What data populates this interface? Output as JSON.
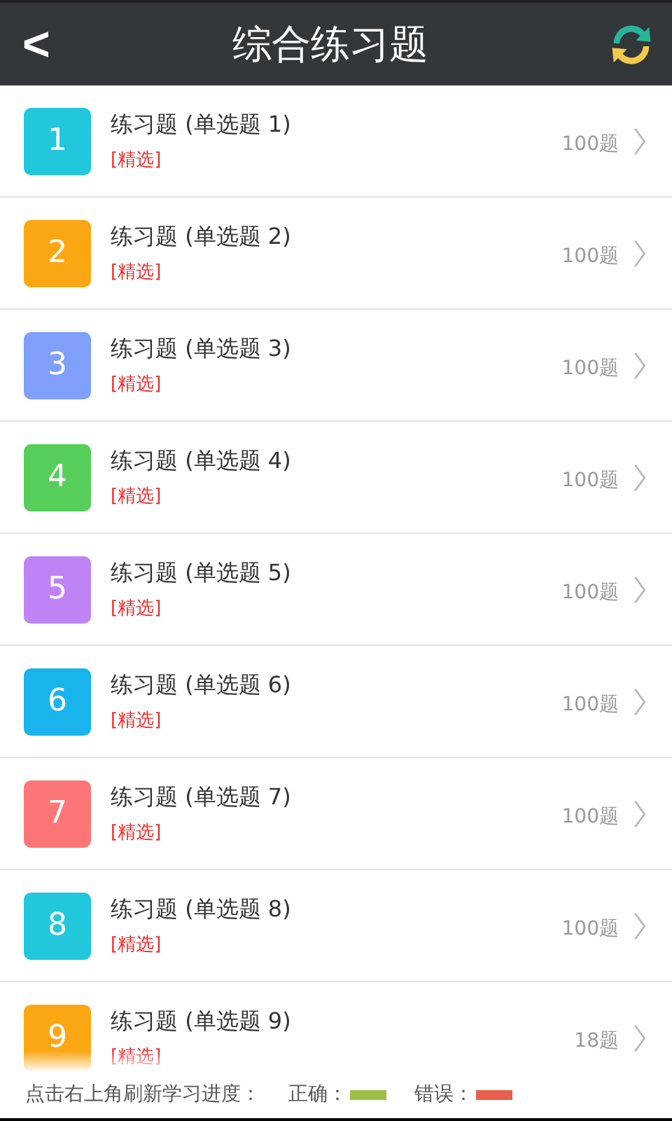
{
  "header": {
    "back": "<",
    "title": "综合练习题"
  },
  "items": [
    {
      "number": "1",
      "color": "#22c7db",
      "title": "练习题 (单选题 1)",
      "tag": "[精选]",
      "count": "100题"
    },
    {
      "number": "2",
      "color": "#fba714",
      "title": "练习题 (单选题 2)",
      "tag": "[精选]",
      "count": "100题"
    },
    {
      "number": "3",
      "color": "#7f9ffb",
      "title": "练习题 (单选题 3)",
      "tag": "[精选]",
      "count": "100题"
    },
    {
      "number": "4",
      "color": "#57ce5a",
      "title": "练习题 (单选题 4)",
      "tag": "[精选]",
      "count": "100题"
    },
    {
      "number": "5",
      "color": "#c083f6",
      "title": "练习题 (单选题 5)",
      "tag": "[精选]",
      "count": "100题"
    },
    {
      "number": "6",
      "color": "#1ab4ec",
      "title": "练习题 (单选题 6)",
      "tag": "[精选]",
      "count": "100题"
    },
    {
      "number": "7",
      "color": "#fc7677",
      "title": "练习题 (单选题 7)",
      "tag": "[精选]",
      "count": "100题"
    },
    {
      "number": "8",
      "color": "#22c7db",
      "title": "练习题 (单选题 8)",
      "tag": "[精选]",
      "count": "100题"
    },
    {
      "number": "9",
      "color": "#fba714",
      "title": "练习题 (单选题 9)",
      "tag": "[精选]",
      "count": "18题"
    }
  ],
  "footer": {
    "hint": "点击右上角刷新学习进度：",
    "legend": [
      {
        "label": "正确：",
        "color": "#9bbf45"
      },
      {
        "label": "错误：",
        "color": "#e8604d"
      }
    ]
  }
}
